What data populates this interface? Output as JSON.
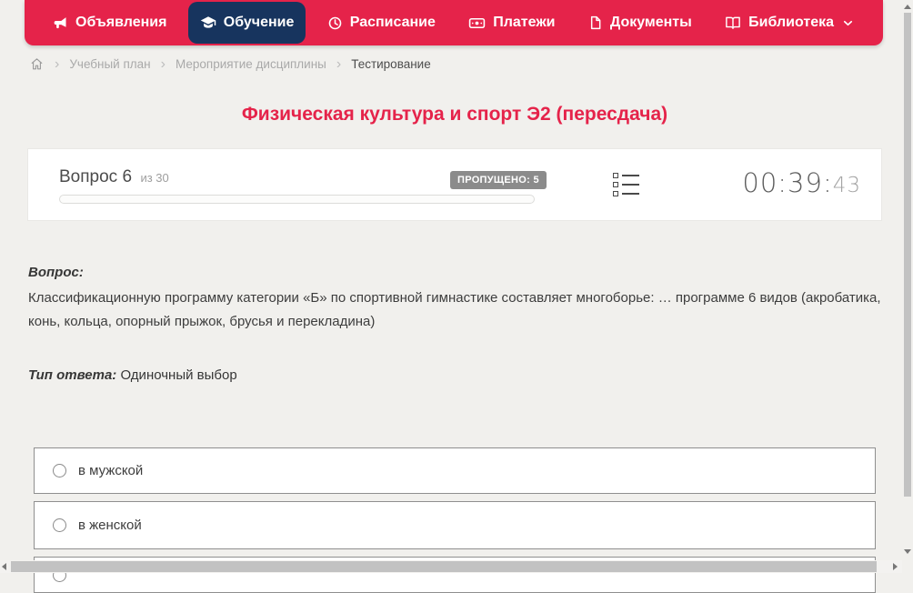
{
  "colors": {
    "accent_red": "#e5234a",
    "active_navy": "#17345e",
    "page_bg": "#f1f0ed",
    "badge_bg": "#8b8b8b"
  },
  "nav": {
    "items": [
      {
        "label": "Объявления",
        "icon": "megaphone-icon",
        "active": false
      },
      {
        "label": "Обучение",
        "icon": "graduation-cap-icon",
        "active": true
      },
      {
        "label": "Расписание",
        "icon": "clock-icon",
        "active": false
      },
      {
        "label": "Платежи",
        "icon": "banknote-icon",
        "active": false
      },
      {
        "label": "Документы",
        "icon": "document-icon",
        "active": false
      },
      {
        "label": "Библиотека",
        "icon": "open-book-icon",
        "active": false,
        "has_dropdown": true
      }
    ]
  },
  "breadcrumb": {
    "items": [
      "Учебный план",
      "Мероприятие дисциплины",
      "Тестирование"
    ],
    "separator": "›"
  },
  "page": {
    "title": "Физическая культура и спорт Э2 (пересдача)"
  },
  "question_panel": {
    "question_label": "Вопрос 6",
    "of_label": "из 30",
    "missed_badge": "ПРОПУЩЕНО: 5",
    "progress_percent": 0,
    "timer_hm": "00:39:",
    "timer_seconds": "43"
  },
  "question": {
    "label": "Вопрос:",
    "text": "Классификационную программу категории «Б» по спортивной гимнастике составляет многоборье: … программе 6 видов (акробатика, конь, кольца, опорный прыжок, брусья и перекладина)",
    "answer_type_label": "Тип ответа:",
    "answer_type_value": "Одиночный выбор"
  },
  "options": [
    {
      "label": "в мужской",
      "selected": false
    },
    {
      "label": "в женской",
      "selected": false
    },
    {
      "label": "",
      "selected": false
    }
  ]
}
